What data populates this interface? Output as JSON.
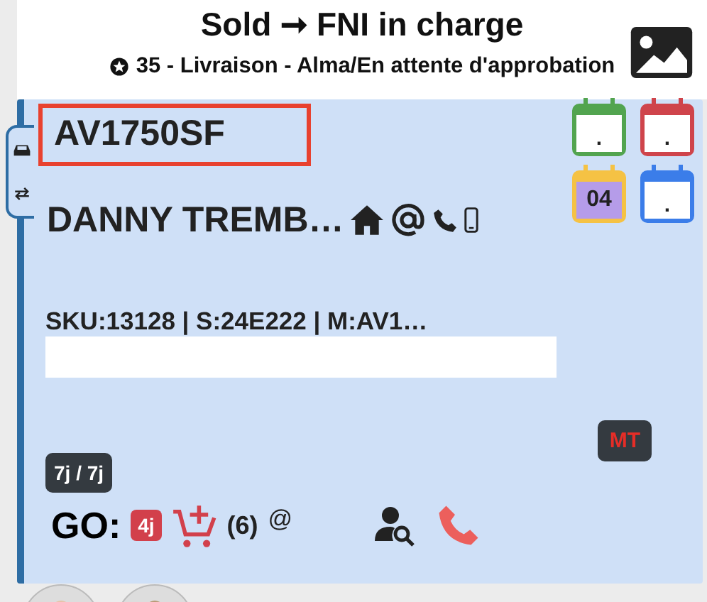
{
  "header": {
    "title": "Sold ➞ FNI in charge",
    "subtitle": "35 - Livraison - Alma/En attente d'approbation"
  },
  "card": {
    "plate": "AV1750SF",
    "plate_highlighted": true,
    "customer": "DANNY TREMB…",
    "sku_line": "SKU:13128 | S:24E222 | M:AV1…",
    "calendars": [
      {
        "text": ".",
        "color": "#52a44f"
      },
      {
        "text": ".",
        "color": "#cf444b"
      },
      {
        "text": "04",
        "color": "#f5c244"
      },
      {
        "text": ".",
        "color": "#3b7de9"
      }
    ],
    "tag": "MT",
    "duration": "7j / 7j",
    "go": {
      "label": "GO:",
      "days": "4j",
      "count": "(6)",
      "at": "@"
    }
  }
}
